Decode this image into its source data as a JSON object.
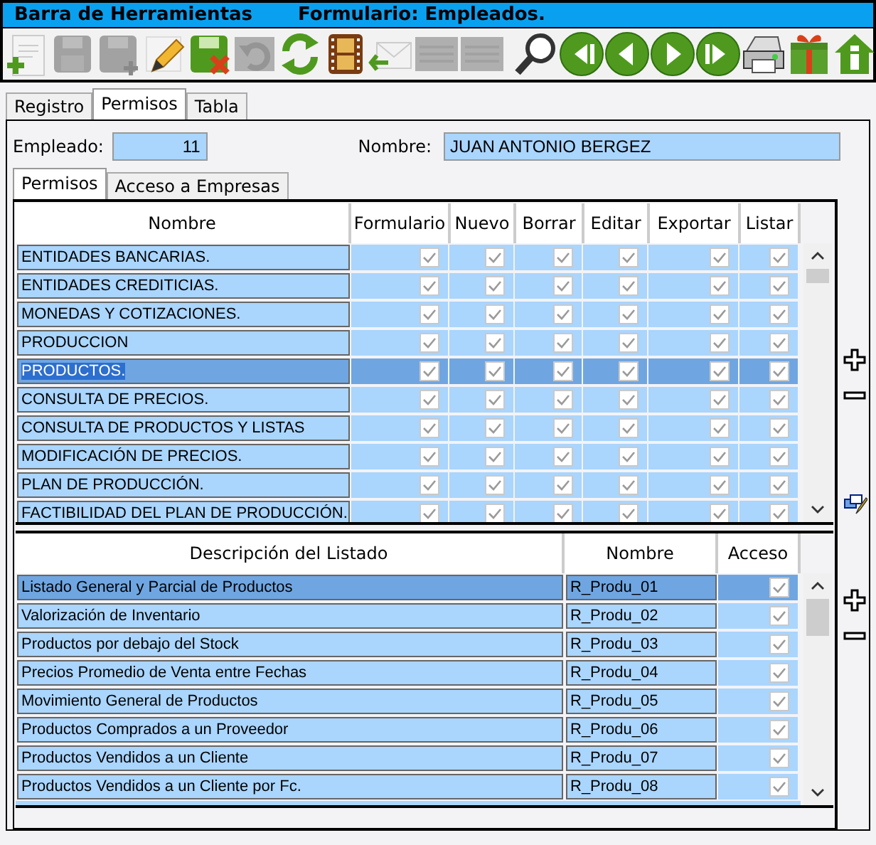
{
  "title_bar": {
    "title": "Barra de Herramientas",
    "form": "Formulario: Empleados."
  },
  "toolbar": [
    {
      "kind": "new",
      "disabled": false
    },
    {
      "kind": "save",
      "disabled": true
    },
    {
      "kind": "saveas",
      "disabled": true
    },
    {
      "kind": "edit",
      "disabled": false
    },
    {
      "kind": "cancel",
      "disabled": false
    },
    {
      "kind": "undo",
      "disabled": true
    },
    {
      "kind": "refresh",
      "disabled": false
    },
    {
      "kind": "film",
      "disabled": false
    },
    {
      "kind": "mail",
      "disabled": false
    },
    {
      "kind": "lines",
      "disabled": true
    },
    {
      "kind": "lines",
      "disabled": true
    },
    {
      "kind": "search",
      "disabled": false
    },
    {
      "kind": "first",
      "disabled": false
    },
    {
      "kind": "prev",
      "disabled": false
    },
    {
      "kind": "next",
      "disabled": false
    },
    {
      "kind": "last",
      "disabled": false
    },
    {
      "kind": "print",
      "disabled": false
    },
    {
      "kind": "gift",
      "disabled": false
    },
    {
      "kind": "home",
      "disabled": false
    }
  ],
  "tabs": [
    {
      "label": "Registro",
      "selected": false
    },
    {
      "label": "Permisos",
      "selected": true
    },
    {
      "label": "Tabla",
      "selected": false
    }
  ],
  "employee": {
    "label": "Empleado:",
    "value": "11"
  },
  "name": {
    "label": "Nombre:",
    "value": "JUAN ANTONIO BERGEZ"
  },
  "sub_tabs": [
    {
      "label": "Permisos",
      "selected": true
    },
    {
      "label": "Acceso a Empresas",
      "selected": false
    }
  ],
  "permissions": {
    "columns": [
      "Nombre",
      "Formulario",
      "Nuevo",
      "Borrar",
      "Editar",
      "Exportar",
      "Listar"
    ],
    "rows": [
      {
        "name": "ENTIDADES BANCARIAS.",
        "selected": false,
        "checks": [
          true,
          true,
          true,
          true,
          true,
          true
        ]
      },
      {
        "name": "ENTIDADES CREDITICIAS.",
        "selected": false,
        "checks": [
          true,
          true,
          true,
          true,
          true,
          true
        ]
      },
      {
        "name": "MONEDAS Y COTIZACIONES.",
        "selected": false,
        "checks": [
          true,
          true,
          true,
          true,
          true,
          true
        ]
      },
      {
        "name": "PRODUCCION",
        "selected": false,
        "checks": [
          true,
          true,
          true,
          true,
          true,
          true
        ]
      },
      {
        "name": "PRODUCTOS.",
        "selected": true,
        "checks": [
          true,
          true,
          true,
          true,
          true,
          true
        ]
      },
      {
        "name": "CONSULTA DE PRECIOS.",
        "selected": false,
        "checks": [
          true,
          true,
          true,
          true,
          true,
          true
        ]
      },
      {
        "name": "CONSULTA DE PRODUCTOS Y LISTAS",
        "selected": false,
        "checks": [
          true,
          true,
          true,
          true,
          true,
          true
        ]
      },
      {
        "name": "MODIFICACIÓN DE PRECIOS.",
        "selected": false,
        "checks": [
          true,
          true,
          true,
          true,
          true,
          true
        ]
      },
      {
        "name": "PLAN DE PRODUCCIÓN.",
        "selected": false,
        "checks": [
          true,
          true,
          true,
          true,
          true,
          true
        ]
      },
      {
        "name": "FACTIBILIDAD DEL PLAN DE PRODUCCIÓN.",
        "selected": false,
        "checks": [
          true,
          true,
          true,
          true,
          true,
          true
        ]
      }
    ]
  },
  "reports": {
    "columns": [
      "Descripción del Listado",
      "Nombre",
      "Acceso"
    ],
    "rows": [
      {
        "description": "Listado General y Parcial de Productos",
        "name": "R_Produ_01",
        "selected": true,
        "access": true
      },
      {
        "description": "Valorización de Inventario",
        "name": "R_Produ_02",
        "selected": false,
        "access": true
      },
      {
        "description": "Productos por debajo del Stock",
        "name": "R_Produ_03",
        "selected": false,
        "access": true
      },
      {
        "description": "Precios Promedio de Venta entre Fechas",
        "name": "R_Produ_04",
        "selected": false,
        "access": true
      },
      {
        "description": "Movimiento General de Productos",
        "name": "R_Produ_05",
        "selected": false,
        "access": true
      },
      {
        "description": "Productos Comprados a un Proveedor",
        "name": "R_Produ_06",
        "selected": false,
        "access": true
      },
      {
        "description": "Productos Vendidos a un Cliente",
        "name": "R_Produ_07",
        "selected": false,
        "access": true
      },
      {
        "description": "Productos Vendidos a un Cliente por Fc.",
        "name": "R_Produ_08",
        "selected": false,
        "access": true
      }
    ]
  }
}
